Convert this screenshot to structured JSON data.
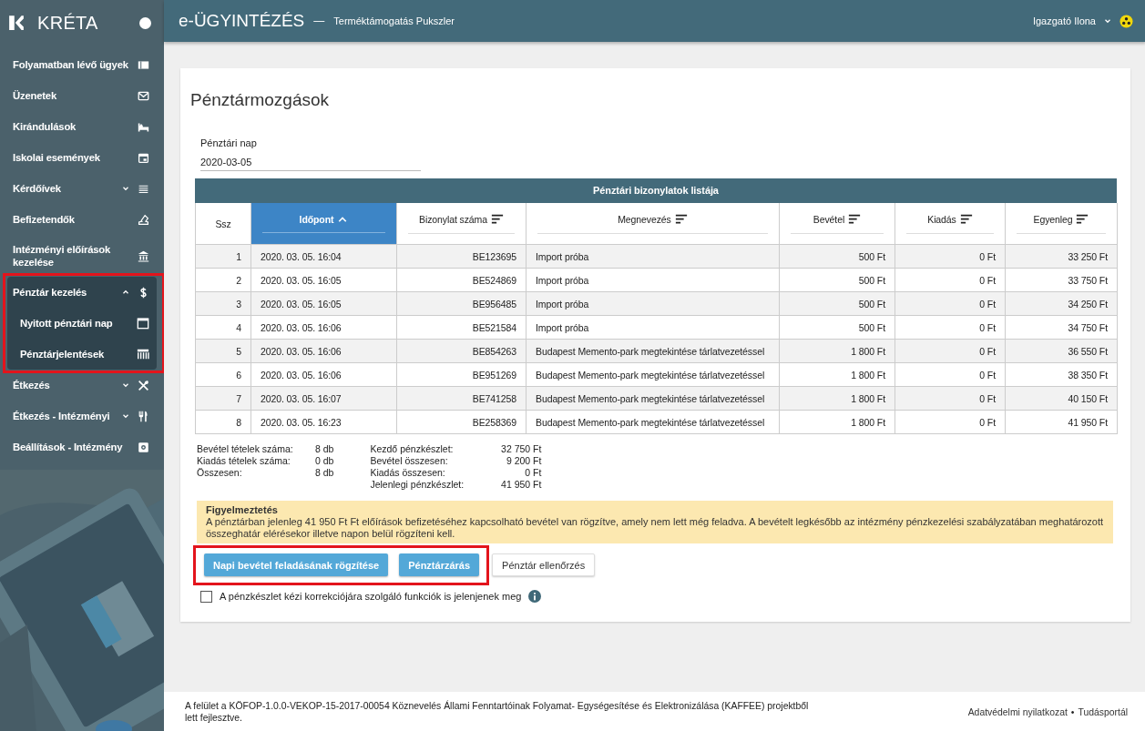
{
  "sidebar": {
    "brand": "KRÉTA",
    "items": [
      {
        "label": "Folyamatban lévő ügyek",
        "kind": "link"
      },
      {
        "label": "Üzenetek",
        "kind": "link"
      },
      {
        "label": "Kirándulások",
        "kind": "link"
      },
      {
        "label": "Iskolai események",
        "kind": "link"
      },
      {
        "label": "Kérdőívek",
        "kind": "group",
        "expanded": false,
        "annotated": false
      },
      {
        "label": "Befizetendők",
        "kind": "link"
      },
      {
        "label": "Intézményi előírások kezelése",
        "kind": "link"
      },
      {
        "label": "Pénztár kezelés",
        "kind": "group",
        "expanded": true,
        "annotated": true,
        "children": [
          {
            "label": "Nyitott pénztári nap"
          },
          {
            "label": "Pénztárjelentések"
          }
        ]
      },
      {
        "label": "Étkezés",
        "kind": "group",
        "expanded": false,
        "annotated": false
      },
      {
        "label": "Étkezés - Intézményi",
        "kind": "group",
        "expanded": false,
        "annotated": false
      },
      {
        "label": "Beállítások - Intézmény",
        "kind": "link"
      }
    ]
  },
  "header": {
    "title": "e-ÜGYINTÉZÉS",
    "dash": "—",
    "subtitle": "Terméktámogatás Pukszler",
    "user": "Igazgató Ilona"
  },
  "page": {
    "title": "Pénztármozgások",
    "date_field": {
      "label": "Pénztári nap",
      "value": "2020-03-05"
    },
    "table": {
      "caption": "Pénztári bizonylatok listája",
      "columns": [
        {
          "label": "Ssz",
          "sortable": false,
          "selected": false,
          "kind": "number"
        },
        {
          "label": "Időpont",
          "sortable": true,
          "selected": true,
          "kind": "text"
        },
        {
          "label": "Bizonylat száma",
          "sortable": true,
          "selected": false,
          "kind": "number"
        },
        {
          "label": "Megnevezés",
          "sortable": true,
          "selected": false,
          "kind": "text"
        },
        {
          "label": "Bevétel",
          "sortable": true,
          "selected": false,
          "kind": "number"
        },
        {
          "label": "Kiadás",
          "sortable": true,
          "selected": false,
          "kind": "number"
        },
        {
          "label": "Egyenleg",
          "sortable": true,
          "selected": false,
          "kind": "number"
        }
      ],
      "rows": [
        [
          "1",
          "2020. 03. 05. 16:04",
          "BE123695",
          "Import próba",
          "500 Ft",
          "0 Ft",
          "33 250 Ft"
        ],
        [
          "2",
          "2020. 03. 05. 16:05",
          "BE524869",
          "Import próba",
          "500 Ft",
          "0 Ft",
          "33 750 Ft"
        ],
        [
          "3",
          "2020. 03. 05. 16:05",
          "BE956485",
          "Import próba",
          "500 Ft",
          "0 Ft",
          "34 250 Ft"
        ],
        [
          "4",
          "2020. 03. 05. 16:06",
          "BE521584",
          "Import próba",
          "500 Ft",
          "0 Ft",
          "34 750 Ft"
        ],
        [
          "5",
          "2020. 03. 05. 16:06",
          "BE854263",
          "Budapest Memento-park megtekintése tárlatvezetéssel",
          "1 800 Ft",
          "0 Ft",
          "36 550 Ft"
        ],
        [
          "6",
          "2020. 03. 05. 16:06",
          "BE951269",
          "Budapest Memento-park megtekintése tárlatvezetéssel",
          "1 800 Ft",
          "0 Ft",
          "38 350 Ft"
        ],
        [
          "7",
          "2020. 03. 05. 16:07",
          "BE741258",
          "Budapest Memento-park megtekintése tárlatvezetéssel",
          "1 800 Ft",
          "0 Ft",
          "40 150 Ft"
        ],
        [
          "8",
          "2020. 03. 05. 16:23",
          "BE258369",
          "Budapest Memento-park megtekintése tárlatvezetéssel",
          "1 800 Ft",
          "0 Ft",
          "41 950 Ft"
        ]
      ]
    },
    "summary_left": [
      {
        "label": "Bevétel tételek száma:",
        "value": "8 db"
      },
      {
        "label": "Kiadás tételek száma:",
        "value": "0 db"
      },
      {
        "label": "Összesen:",
        "value": "8 db"
      }
    ],
    "summary_right": [
      {
        "label": "Kezdő pénzkészlet:",
        "value": "32 750 Ft"
      },
      {
        "label": "Bevétel összesen:",
        "value": "9 200 Ft"
      },
      {
        "label": "Kiadás összesen:",
        "value": "0 Ft"
      },
      {
        "label": "Jelenlegi pénzkészlet:",
        "value": "41 950 Ft"
      }
    ],
    "warning": {
      "title": "Figyelmeztetés",
      "text": "A pénztárban jelenleg 41 950 Ft Ft előírások befizetéséhez kapcsolható bevétel van rögzítve, amely nem lett még feladva. A bevételt legkésőbb az intézmény pénzkezelési szabályzatában meghatározott összeghatár elérésekor illetve napon belül rögzíteni kell."
    },
    "button_groups": [
      {
        "annotated": true,
        "buttons": [
          {
            "label": "Napi bevétel feladásának rögzítése",
            "kind": "primary"
          },
          {
            "label": "Pénztárzárás",
            "kind": "primary"
          }
        ]
      },
      {
        "annotated": false,
        "buttons": [
          {
            "label": "Pénztár ellenőrzés",
            "kind": "default"
          }
        ]
      }
    ],
    "checkbox": {
      "label": "A pénzkészlet kézi korrekciójára szolgáló funkciók is jelenjenek meg",
      "checked": false
    }
  },
  "footer": {
    "text": "A felület a KÖFOP-1.0.0-VEKOP-15-2017-00054 Köznevelés Állami Fenntartóinak Folyamat- Egységesítése és Elektronizálása (KAFFEE) projektből lett fejlesztve.",
    "links": [
      "Adatvédelmi nyilatkozat",
      "Tudásportál"
    ],
    "separator": "•"
  }
}
